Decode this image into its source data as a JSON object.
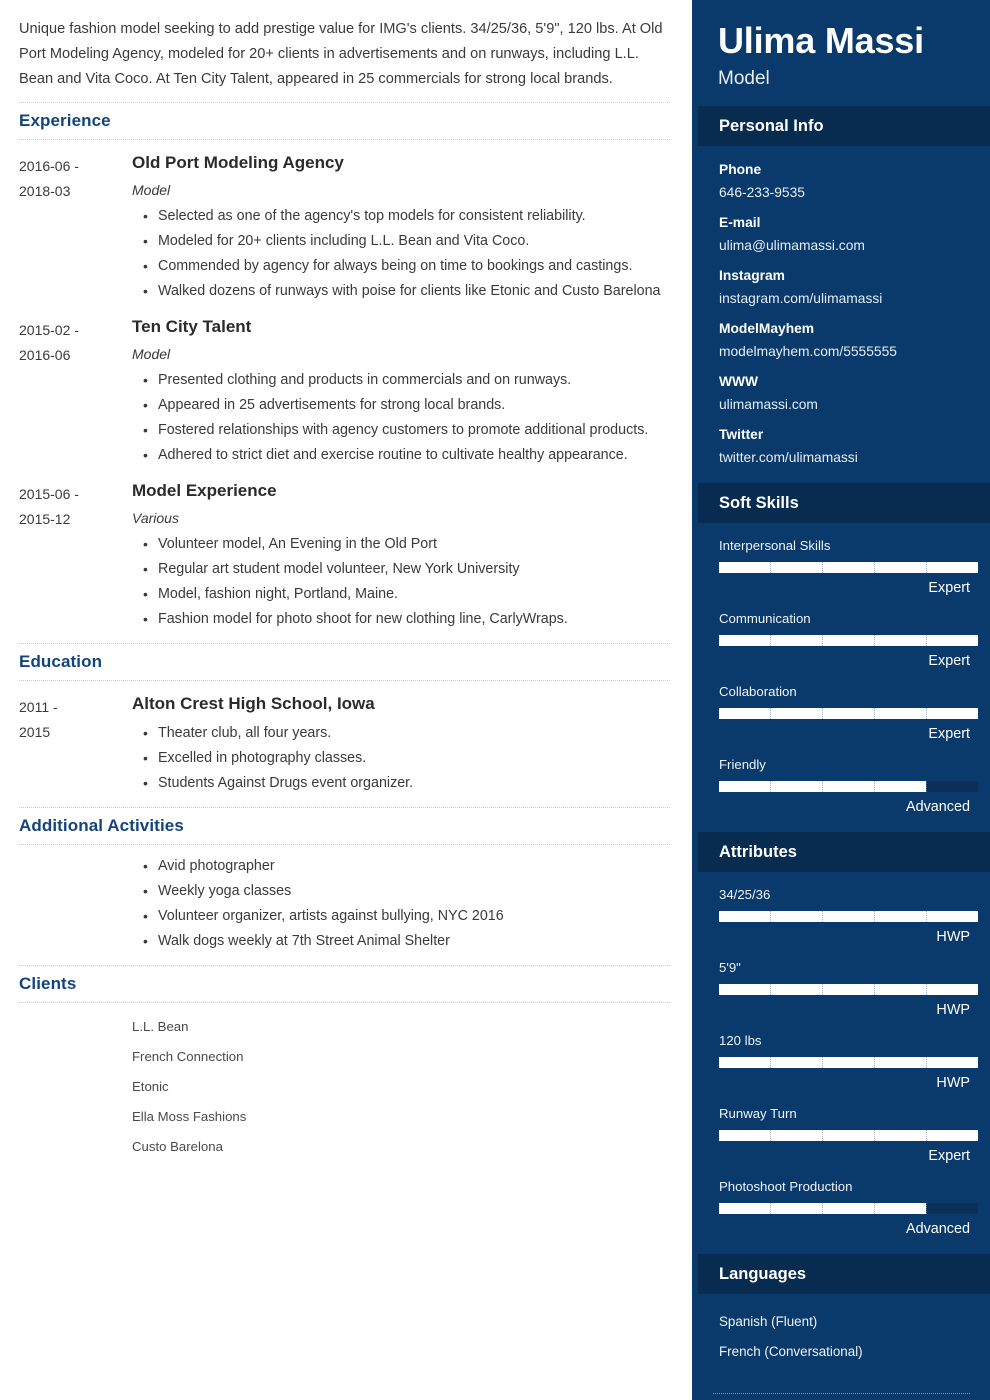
{
  "theme": {
    "accent_heading": "#14447c",
    "sidebar_bg": "#0a3a6b",
    "sidebar_header_bg": "#082b50",
    "bar_fill": "#ffffff",
    "bar_track": "#0b2f56"
  },
  "summary": {
    "text": "Unique fashion model seeking to add prestige value for IMG's clients. 34/25/36, 5'9\", 120 lbs. At Old Port Modeling Agency, modeled for 20+ clients in advertisements and on runways, including L.L. Bean and Vita Coco. At Ten City Talent, appeared in 25 commercials for strong local brands."
  },
  "sections": {
    "experience": {
      "title": "Experience",
      "entries": [
        {
          "dates": "2016-06 - 2018-03",
          "date_from": "2016-06 -",
          "date_to": "2018-03",
          "title": "Old Port Modeling Agency",
          "subtitle": "Model",
          "bullets": [
            "Selected as one of the agency's top models for consistent reliability.",
            "Modeled for 20+ clients including L.L. Bean and Vita Coco.",
            "Commended by agency for always being on time to bookings and castings.",
            "Walked dozens of runways with poise for clients like Etonic and Custo Barelona"
          ]
        },
        {
          "dates": "2015-02 - 2016-06",
          "date_from": "2015-02 -",
          "date_to": "2016-06",
          "title": "Ten City Talent",
          "subtitle": "Model",
          "bullets": [
            "Presented clothing and products in commercials and on runways.",
            "Appeared in 25 advertisements for strong local brands.",
            "Fostered relationships with agency customers to promote additional products.",
            "Adhered to strict diet and exercise routine to cultivate healthy appearance."
          ]
        },
        {
          "dates": "2015-06 - 2015-12",
          "date_from": "2015-06 -",
          "date_to": "2015-12",
          "title": "Model Experience",
          "subtitle": "Various",
          "bullets": [
            "Volunteer model, An Evening in the Old Port",
            "Regular art student model volunteer, New York University",
            "Model, fashion night, Portland, Maine.",
            "Fashion model for photo shoot for new clothing line, CarlyWraps."
          ]
        }
      ]
    },
    "education": {
      "title": "Education",
      "entries": [
        {
          "date_from": "2011 -",
          "date_to": "2015",
          "title": "Alton Crest High School, Iowa",
          "subtitle": "",
          "bullets": [
            "Theater club, all four years.",
            "Excelled in photography classes.",
            "Students Against Drugs event organizer."
          ]
        }
      ]
    },
    "additional_activities": {
      "title": "Additional Activities",
      "bullets": [
        "Avid photographer",
        "Weekly yoga classes",
        "Volunteer organizer, artists against bullying, NYC 2016",
        "Walk dogs weekly at 7th Street Animal Shelter"
      ]
    },
    "clients": {
      "title": "Clients",
      "items": [
        "L.L. Bean",
        "French Connection",
        "Etonic",
        "Ella Moss Fashions",
        "Custo Barelona"
      ]
    }
  },
  "sidebar": {
    "name": "Ulima Massi",
    "role": "Model",
    "personal_info": {
      "title": "Personal Info",
      "fields": [
        {
          "label": "Phone",
          "value": "646-233-9535"
        },
        {
          "label": "E-mail",
          "value": "ulima@ulimamassi.com"
        },
        {
          "label": "Instagram",
          "value": "instagram.com/ulimamassi"
        },
        {
          "label": "ModelMayhem",
          "value": "modelmayhem.com/5555555"
        },
        {
          "label": "WWW",
          "value": "ulimamassi.com"
        },
        {
          "label": "Twitter",
          "value": "twitter.com/ulimamassi"
        }
      ]
    },
    "soft_skills": {
      "title": "Soft Skills",
      "items": [
        {
          "name": "Interpersonal Skills",
          "level": "Expert",
          "percent": 100
        },
        {
          "name": "Communication",
          "level": "Expert",
          "percent": 100
        },
        {
          "name": "Collaboration",
          "level": "Expert",
          "percent": 100
        },
        {
          "name": "Friendly",
          "level": "Advanced",
          "percent": 80
        }
      ]
    },
    "attributes": {
      "title": "Attributes",
      "items": [
        {
          "name": "34/25/36",
          "level": "HWP",
          "percent": 100
        },
        {
          "name": "5'9\"",
          "level": "HWP",
          "percent": 100
        },
        {
          "name": "120 lbs",
          "level": "HWP",
          "percent": 100
        },
        {
          "name": "Runway Turn",
          "level": "Expert",
          "percent": 100
        },
        {
          "name": "Photoshoot Production",
          "level": "Advanced",
          "percent": 80
        }
      ]
    },
    "languages": {
      "title": "Languages",
      "items": [
        "Spanish (Fluent)",
        "French (Conversational)"
      ]
    }
  }
}
